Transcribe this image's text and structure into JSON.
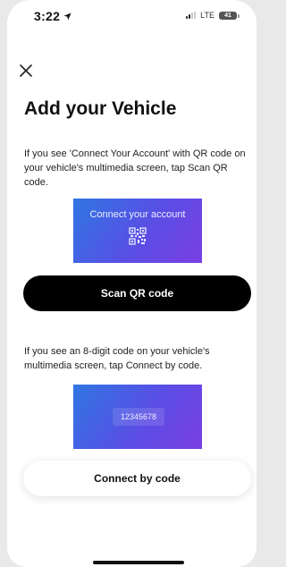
{
  "status_bar": {
    "time": "3:22",
    "network": "LTE",
    "battery": "41"
  },
  "header": {
    "close_icon": "close-icon",
    "title": "Add your Vehicle"
  },
  "section_qr": {
    "description": "If you see 'Connect Your Account' with QR code on your vehicle's multimedia screen, tap Scan QR code.",
    "preview_title": "Connect your account",
    "preview_icon": "qr-code-icon",
    "button_label": "Scan QR code"
  },
  "section_code": {
    "description": "If you see an 8-digit code on your vehicle's multimedia screen, tap Connect by code.",
    "preview_code": "12345678",
    "button_label": "Connect by code"
  },
  "colors": {
    "primary_button": "#000000",
    "gradient_start": "#2f76e3",
    "gradient_end": "#7a3ee2"
  }
}
